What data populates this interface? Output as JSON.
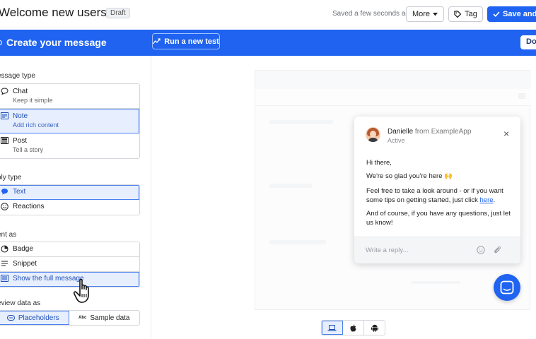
{
  "header": {
    "title": "Welcome new users",
    "badge": "Draft",
    "saved_text": "Saved a few seconds ago",
    "more_label": "More",
    "tag_label": "Tag",
    "save_label": "Save and c"
  },
  "banner": {
    "title": "Create your message",
    "test_label": "Run a new test",
    "done_label": "Do",
    "color": "#1f63f0"
  },
  "sidebar": {
    "message_type_label": "essage type",
    "message_types": [
      {
        "name": "Chat",
        "sub": "Keep it simple",
        "icon": "chat-bubble-icon",
        "selected": false
      },
      {
        "name": "Note",
        "sub": "Add rich content",
        "icon": "note-icon",
        "selected": true
      },
      {
        "name": "Post",
        "sub": "Tell a story",
        "icon": "post-icon",
        "selected": false
      }
    ],
    "reply_type_label": "ply type",
    "reply_types": [
      {
        "name": "Text",
        "icon": "text-bubble-icon",
        "selected": true
      },
      {
        "name": "Reactions",
        "icon": "smiley-icon",
        "selected": false
      }
    ],
    "sent_as_label": "ent as",
    "sent_as": [
      {
        "name": "Badge",
        "icon": "badge-icon",
        "selected": false
      },
      {
        "name": "Snippet",
        "icon": "snippet-icon",
        "selected": false
      },
      {
        "name": "Show the full message",
        "icon": "full-message-icon",
        "selected": true
      }
    ],
    "preview_label": "eview data as",
    "preview_options": [
      {
        "name": "Placeholders",
        "selected": true
      },
      {
        "name": "Sample data",
        "icon_text": "Abc",
        "selected": false
      }
    ]
  },
  "chat": {
    "sender": "Danielle",
    "from_text": "from ExampleApp",
    "status": "Active",
    "greeting": "Hi there,",
    "line1": "We're so glad you're here 🙌",
    "line2_pre": "Feel free to take a look around - or if you want some tips on getting started, just click ",
    "link": "here",
    "line2_post": ".",
    "line3": "And of course, if you have any questions, just let us know!",
    "reply_placeholder": "Write a reply..."
  },
  "devices": [
    {
      "icon": "laptop-icon",
      "selected": true
    },
    {
      "icon": "apple-icon",
      "selected": false
    },
    {
      "icon": "android-icon",
      "selected": false
    }
  ]
}
